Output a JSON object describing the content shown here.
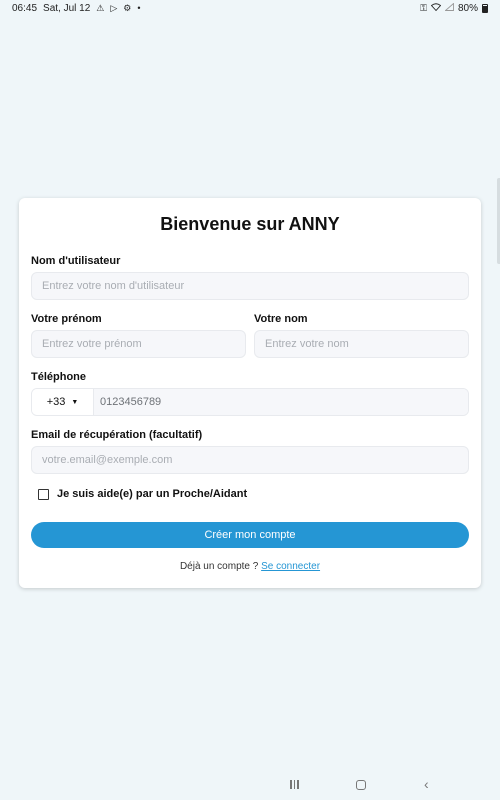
{
  "status_bar": {
    "time": "06:45",
    "date": "Sat, Jul 12",
    "dot": "•",
    "battery": "80%",
    "left_icons": [
      "warning-icon",
      "play-store-icon",
      "settings-icon"
    ],
    "right_icons": [
      "key-icon",
      "wifi-icon",
      "signal-icon",
      "battery-icon"
    ]
  },
  "form": {
    "title": "Bienvenue sur ANNY",
    "username": {
      "label": "Nom d'utilisateur",
      "placeholder": "Entrez votre nom d'utilisateur"
    },
    "firstname": {
      "label": "Votre prénom",
      "placeholder": "Entrez votre prénom"
    },
    "lastname": {
      "label": "Votre nom",
      "placeholder": "Entrez votre nom"
    },
    "phone": {
      "label": "Téléphone",
      "country_code": "+33",
      "placeholder": "0123456789"
    },
    "email": {
      "label": "Email de récupération (facultatif)",
      "placeholder": "votre.email@exemple.com"
    },
    "caregiver_checkbox": {
      "label": "Je suis aide(e) par un Proche/Aidant",
      "checked": false
    },
    "submit_label": "Créer mon compte",
    "login_prompt": "Déjà un compte ?",
    "login_link": "Se connecter"
  },
  "colors": {
    "background": "#eff6f9",
    "accent": "#2596d4",
    "input_bg": "#f6f7fa"
  }
}
